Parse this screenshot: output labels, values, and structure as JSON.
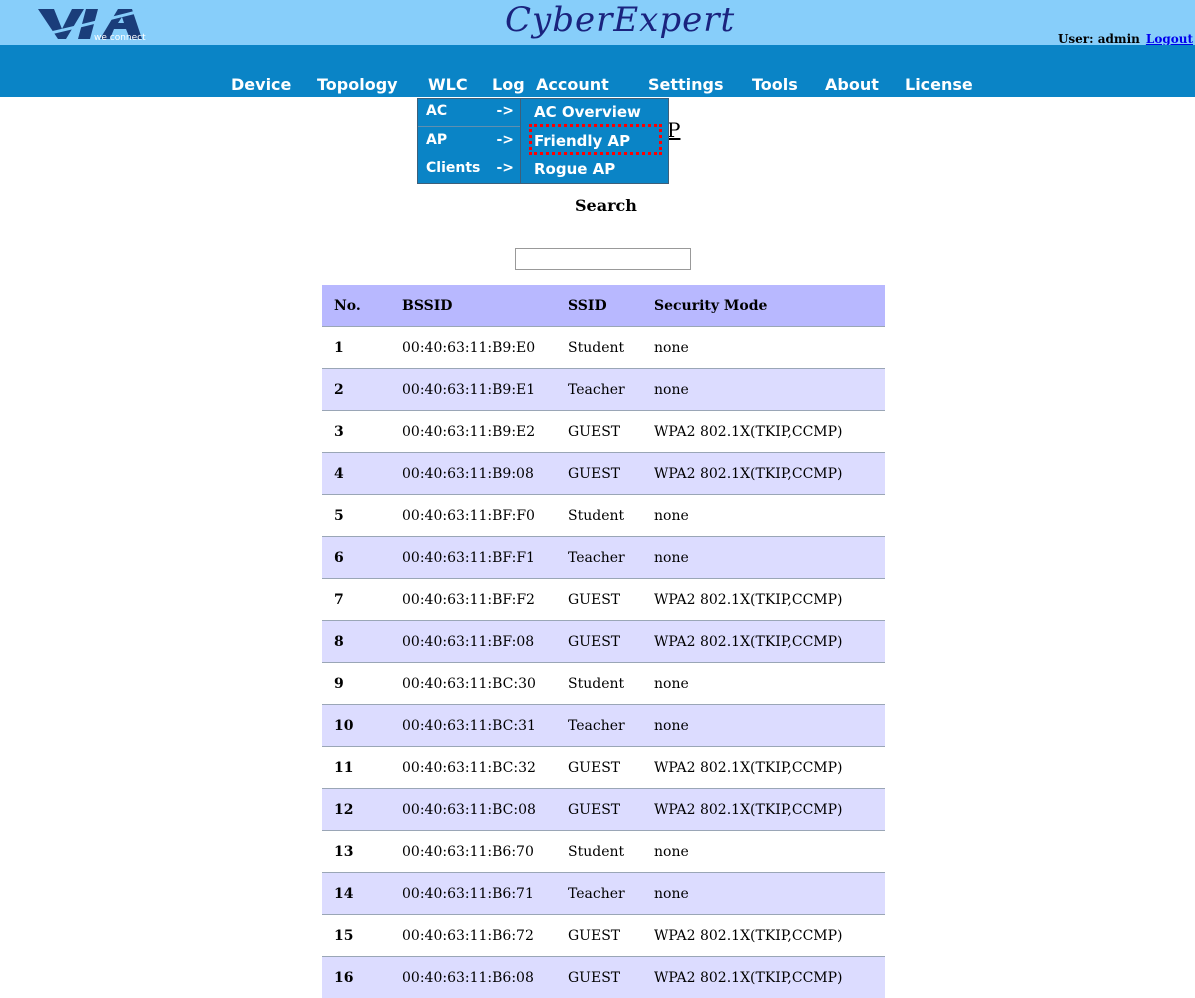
{
  "header": {
    "brand": "CyberExpert",
    "logo_tagline": "we connect",
    "user_text": "User: admin",
    "logout_label": "Logout"
  },
  "nav": {
    "items": [
      "Device",
      "Topology",
      "WLC",
      "Log",
      "Account",
      "Settings",
      "Tools",
      "About",
      "License"
    ]
  },
  "wlc_menu": {
    "items": [
      {
        "label": "AC",
        "arrow": "->"
      },
      {
        "label": "AP",
        "arrow": "->"
      },
      {
        "label": "Clients",
        "arrow": "->"
      }
    ],
    "submenu": [
      "AC Overview",
      "Friendly AP",
      "Rogue AP"
    ]
  },
  "page": {
    "partial_title": "P",
    "search_label": "Search",
    "search_value": ""
  },
  "table": {
    "headers": [
      "No.",
      "BSSID",
      "SSID",
      "Security Mode"
    ],
    "rows": [
      [
        "1",
        "00:40:63:11:B9:E0",
        "Student",
        "none"
      ],
      [
        "2",
        "00:40:63:11:B9:E1",
        "Teacher",
        "none"
      ],
      [
        "3",
        "00:40:63:11:B9:E2",
        "GUEST",
        "WPA2 802.1X(TKIP,CCMP)"
      ],
      [
        "4",
        "00:40:63:11:B9:08",
        "GUEST",
        "WPA2 802.1X(TKIP,CCMP)"
      ],
      [
        "5",
        "00:40:63:11:BF:F0",
        "Student",
        "none"
      ],
      [
        "6",
        "00:40:63:11:BF:F1",
        "Teacher",
        "none"
      ],
      [
        "7",
        "00:40:63:11:BF:F2",
        "GUEST",
        "WPA2 802.1X(TKIP,CCMP)"
      ],
      [
        "8",
        "00:40:63:11:BF:08",
        "GUEST",
        "WPA2 802.1X(TKIP,CCMP)"
      ],
      [
        "9",
        "00:40:63:11:BC:30",
        "Student",
        "none"
      ],
      [
        "10",
        "00:40:63:11:BC:31",
        "Teacher",
        "none"
      ],
      [
        "11",
        "00:40:63:11:BC:32",
        "GUEST",
        "WPA2 802.1X(TKIP,CCMP)"
      ],
      [
        "12",
        "00:40:63:11:BC:08",
        "GUEST",
        "WPA2 802.1X(TKIP,CCMP)"
      ],
      [
        "13",
        "00:40:63:11:B6:70",
        "Student",
        "none"
      ],
      [
        "14",
        "00:40:63:11:B6:71",
        "Teacher",
        "none"
      ],
      [
        "15",
        "00:40:63:11:B6:72",
        "GUEST",
        "WPA2 802.1X(TKIP,CCMP)"
      ],
      [
        "16",
        "00:40:63:11:B6:08",
        "GUEST",
        "WPA2 802.1X(TKIP,CCMP)"
      ]
    ]
  },
  "colors": {
    "header_bg": "#87cefa",
    "nav_bg": "#0a84c6",
    "table_header": "#b8b8ff",
    "row_alt": "#dcdcff",
    "highlight": "#ff0000"
  }
}
